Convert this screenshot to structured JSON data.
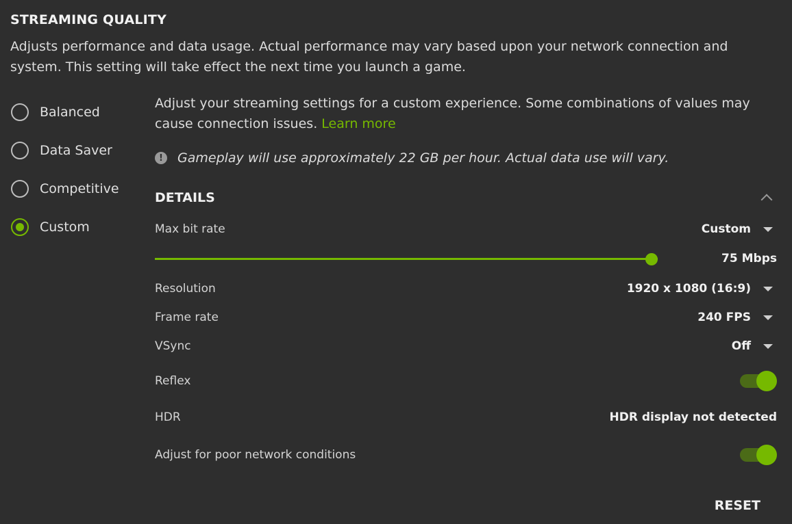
{
  "section": {
    "title": "STREAMING QUALITY",
    "description": "Adjusts performance and data usage. Actual performance may vary based upon your network connection and system. This setting will take effect the next time you launch a game."
  },
  "presets": [
    {
      "label": "Balanced",
      "selected": false
    },
    {
      "label": "Data Saver",
      "selected": false
    },
    {
      "label": "Competitive",
      "selected": false
    },
    {
      "label": "Custom",
      "selected": true
    }
  ],
  "custom": {
    "description": "Adjust your streaming settings for a custom experience. Some combinations of values may cause connection issues.",
    "link_text": "Learn more",
    "notice": "Gameplay will use approximately 22 GB per hour. Actual data use will vary.",
    "notice_icon": "!"
  },
  "details": {
    "title": "DETAILS",
    "max_bit_rate": {
      "label": "Max bit rate",
      "value": "Custom",
      "slider_value": "75 Mbps",
      "slider_fraction": 1.0
    },
    "resolution": {
      "label": "Resolution",
      "value": "1920 x 1080 (16:9)"
    },
    "frame_rate": {
      "label": "Frame rate",
      "value": "240 FPS"
    },
    "vsync": {
      "label": "VSync",
      "value": "Off"
    },
    "reflex": {
      "label": "Reflex",
      "enabled": true
    },
    "hdr": {
      "label": "HDR",
      "value": "HDR display not detected"
    },
    "poor_network": {
      "label": "Adjust for poor network conditions",
      "enabled": true
    }
  },
  "reset_label": "RESET",
  "colors": {
    "accent": "#76b900",
    "background": "#2e2e2e"
  }
}
